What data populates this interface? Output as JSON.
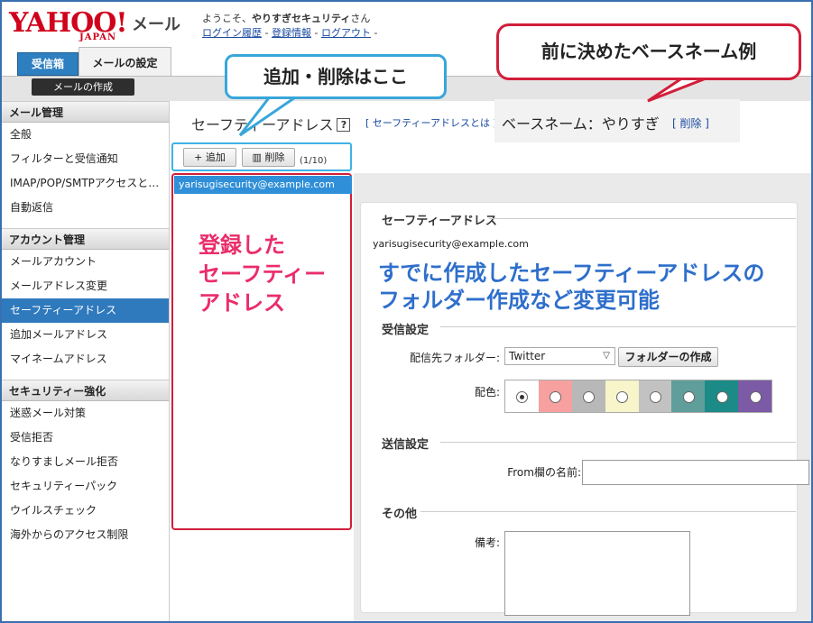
{
  "header": {
    "logo_main": "YAHOO!",
    "logo_sub": "JAPAN",
    "app_name": "メール",
    "welcome_prefix": "ようこそ、",
    "user_name": "やりすぎセキュリティ",
    "welcome_suffix": "さん",
    "links": [
      "ログイン履歴",
      "登録情報",
      "ログアウト"
    ],
    "separator": "-"
  },
  "tabs": {
    "inbox": "受信箱",
    "settings": "メールの設定"
  },
  "compose_label": "メールの作成",
  "sidebar": {
    "sections": [
      {
        "title": "メール管理",
        "items": [
          "全般",
          "フィルターと受信通知",
          "IMAP/POP/SMTPアクセスと…",
          "自動返信"
        ]
      },
      {
        "title": "アカウント管理",
        "items": [
          "メールアカウント",
          "メールアドレス変更",
          "セーフティーアドレス",
          "追加メールアドレス",
          "マイネームアドレス"
        ]
      },
      {
        "title": "セキュリティー強化",
        "items": [
          "迷惑メール対策",
          "受信拒否",
          "なりすましメール拒否",
          "セキュリティーパック",
          "ウイルスチェック",
          "海外からのアクセス制限"
        ]
      }
    ],
    "active_item": "セーフティーアドレス"
  },
  "main": {
    "title": "セーフティーアドレス",
    "help_icon": "?",
    "about_link": "[ セーフティーアドレスとは ]",
    "base_name_label": "ベースネーム：やりすぎ",
    "base_delete": "[ 削除 ]",
    "add_button": "+ 追加",
    "delete_button": "削除",
    "count": "(1/10)",
    "addresses": [
      "yarisugisecurity@example.com"
    ]
  },
  "detail": {
    "section_address": "セーフティーアドレス",
    "email": "yarisugisecurity@example.com",
    "section_receive": "受信設定",
    "folder_label": "配信先フォルダー:",
    "folder_value": "Twitter",
    "folder_create_button": "フォルダーの作成",
    "color_label": "配色:",
    "colors": [
      "#ffffff",
      "#f6a0a0",
      "#b8b8b8",
      "#f7f5c9",
      "#c2c2c2",
      "#5f9e9b",
      "#1c8a86",
      "#7b5aa6"
    ],
    "selected_color_index": 0,
    "section_send": "送信設定",
    "from_label": "From欄の名前:",
    "from_value": "",
    "section_other": "その他",
    "notes_label": "備考:",
    "notes_value": ""
  },
  "annotations": {
    "add_delete": "追加・削除はここ",
    "base_example": "前に決めたベースネーム例",
    "registered": [
      "登録した",
      "セーフティー",
      "アドレス"
    ],
    "changeable": [
      "すでに作成したセーフティーアドレスの",
      "フォルダー作成など変更可能"
    ]
  }
}
